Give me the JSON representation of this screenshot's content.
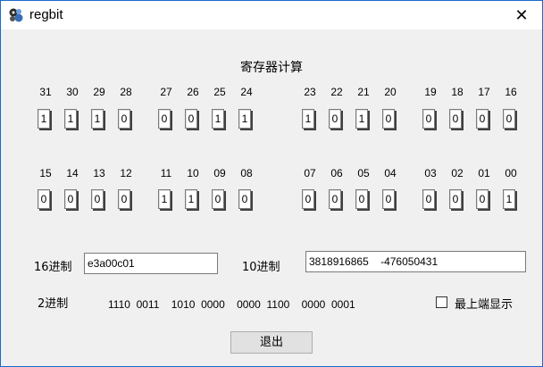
{
  "window": {
    "title": "regbit",
    "app_icon": "regbit-app-icon",
    "close_glyph": "✕"
  },
  "main": {
    "heading": "寄存器计算",
    "row1": [
      {
        "label": "31",
        "value": "1"
      },
      {
        "label": "30",
        "value": "1"
      },
      {
        "label": "29",
        "value": "1"
      },
      {
        "label": "28",
        "value": "0"
      },
      {
        "label": "27",
        "value": "0"
      },
      {
        "label": "26",
        "value": "0"
      },
      {
        "label": "25",
        "value": "1"
      },
      {
        "label": "24",
        "value": "1"
      },
      {
        "label": "23",
        "value": "1"
      },
      {
        "label": "22",
        "value": "0"
      },
      {
        "label": "21",
        "value": "1"
      },
      {
        "label": "20",
        "value": "0"
      },
      {
        "label": "19",
        "value": "0"
      },
      {
        "label": "18",
        "value": "0"
      },
      {
        "label": "17",
        "value": "0"
      },
      {
        "label": "16",
        "value": "0"
      }
    ],
    "row2": [
      {
        "label": "15",
        "value": "0"
      },
      {
        "label": "14",
        "value": "0"
      },
      {
        "label": "13",
        "value": "0"
      },
      {
        "label": "12",
        "value": "0"
      },
      {
        "label": "11",
        "value": "1"
      },
      {
        "label": "10",
        "value": "1"
      },
      {
        "label": "09",
        "value": "0"
      },
      {
        "label": "08",
        "value": "0"
      },
      {
        "label": "07",
        "value": "0"
      },
      {
        "label": "06",
        "value": "0"
      },
      {
        "label": "05",
        "value": "0"
      },
      {
        "label": "04",
        "value": "0"
      },
      {
        "label": "03",
        "value": "0"
      },
      {
        "label": "02",
        "value": "0"
      },
      {
        "label": "01",
        "value": "0"
      },
      {
        "label": "00",
        "value": "1"
      }
    ],
    "hex_label": "16进制",
    "hex_value": "e3a00c01",
    "dec_label": "10进制",
    "dec_value": "3818916865    -476050431",
    "bin_label": "2进制",
    "bin_value": "1110  0011    1010  0000    0000  1100    0000  0001",
    "topmost_label": "最上端显示",
    "topmost_checked": false,
    "exit_label": "退出"
  }
}
